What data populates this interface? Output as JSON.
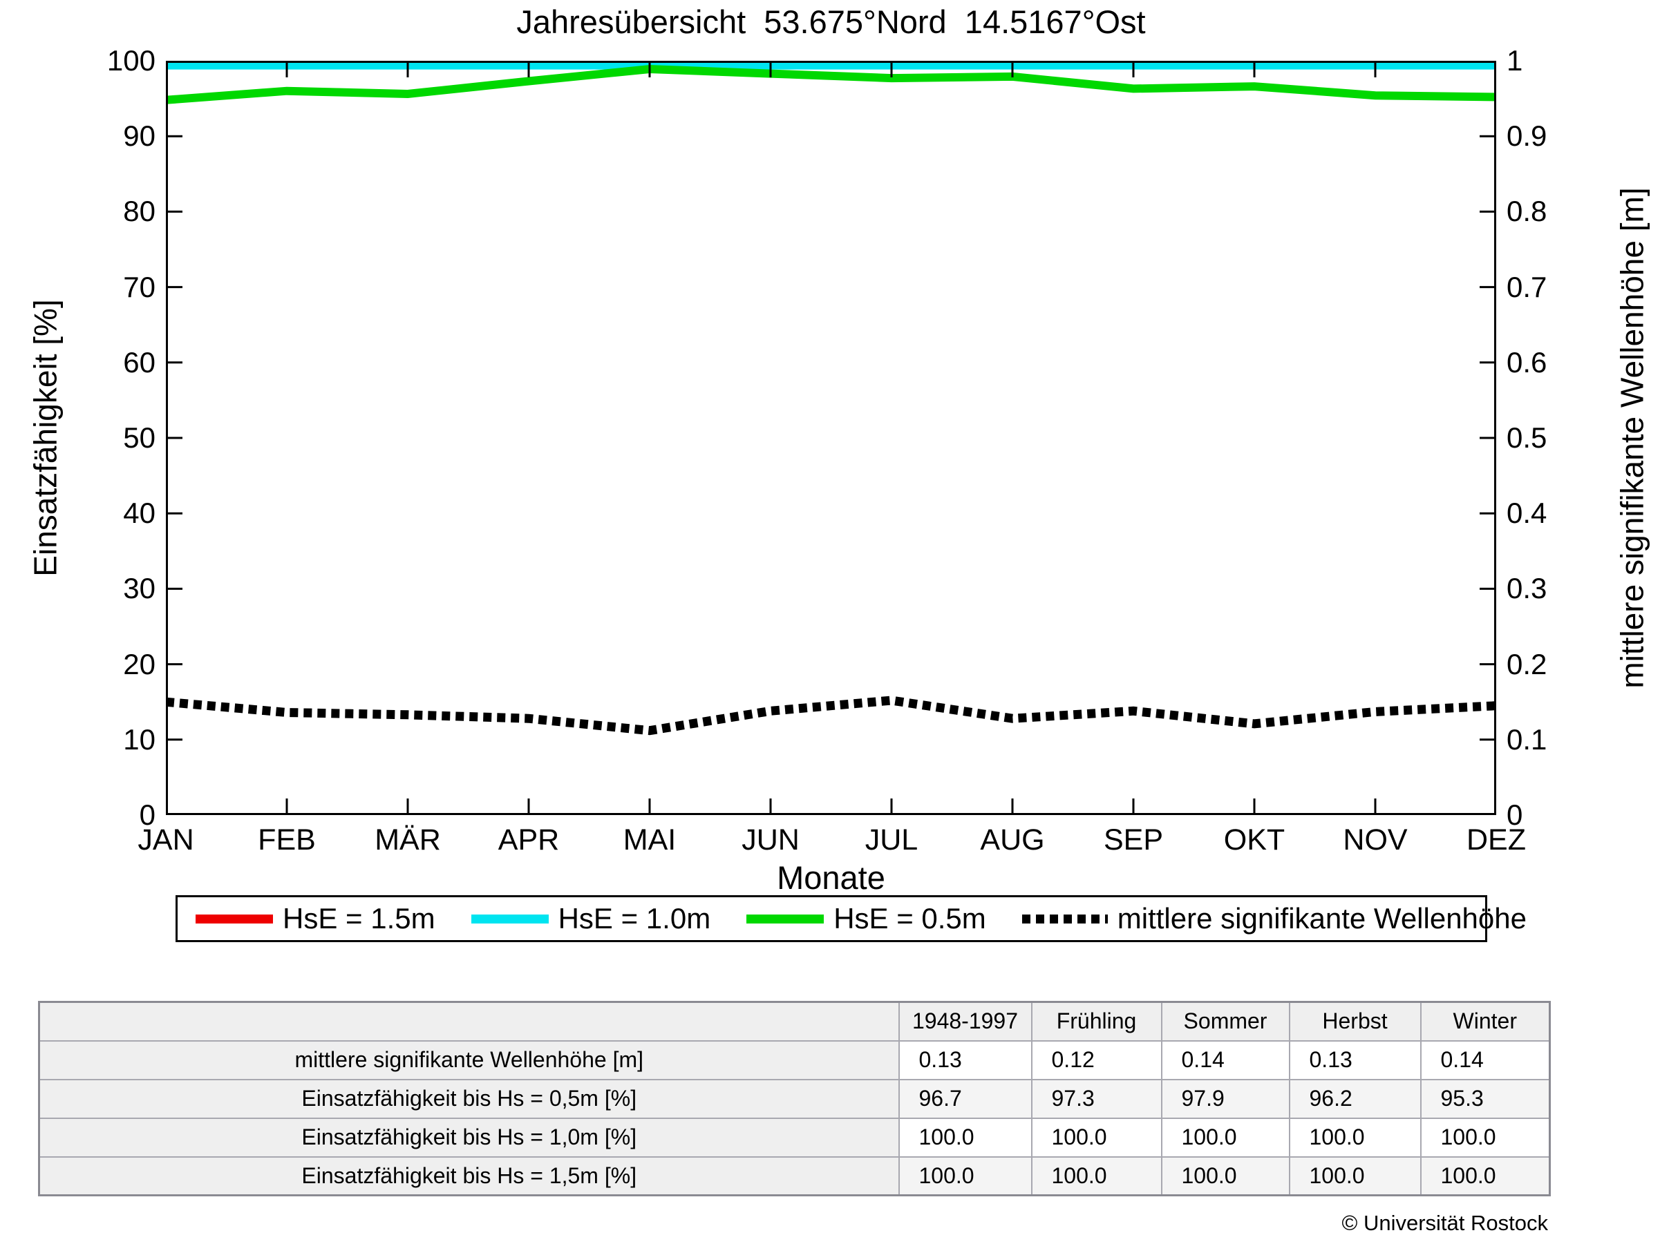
{
  "title": "Jahresübersicht  53.675°Nord  14.5167°Ost",
  "chart_data": {
    "type": "line",
    "categories": [
      "JAN",
      "FEB",
      "MÄR",
      "APR",
      "MAI",
      "JUN",
      "JUL",
      "AUG",
      "SEP",
      "OKT",
      "NOV",
      "DEZ"
    ],
    "xlabel": "Monate",
    "left_axis": {
      "label": "Einsatzfähigkeit [%]",
      "range": [
        0,
        100
      ],
      "ticks": [
        "0",
        "10",
        "20",
        "30",
        "40",
        "50",
        "60",
        "70",
        "80",
        "90",
        "100"
      ]
    },
    "right_axis": {
      "label": "mittlere signifikante Wellenhöhe [m]",
      "range": [
        0,
        1
      ],
      "ticks": [
        "0",
        "0.1",
        "0.2",
        "0.3",
        "0.4",
        "0.5",
        "0.6",
        "0.7",
        "0.8",
        "0.9",
        "1"
      ]
    },
    "grid": false,
    "legend_position": "bottom",
    "series": [
      {
        "name": "HsE = 1.5m",
        "color": "#ee0000",
        "axis": "left",
        "style": "solid",
        "values": [
          100,
          100,
          100,
          100,
          100,
          100,
          100,
          100,
          100,
          100,
          100,
          100
        ]
      },
      {
        "name": "HsE = 1.0m",
        "color": "#00e4f0",
        "axis": "left",
        "style": "solid",
        "values": [
          99.4,
          99.4,
          99.4,
          99.4,
          99.4,
          99.4,
          99.4,
          99.4,
          99.4,
          99.4,
          99.4,
          99.4
        ]
      },
      {
        "name": "HsE = 0.5m",
        "color": "#00d800",
        "axis": "left",
        "style": "solid",
        "values": [
          94.8,
          96.0,
          95.6,
          97.3,
          98.9,
          98.3,
          97.7,
          97.9,
          96.3,
          96.6,
          95.4,
          95.2
        ]
      },
      {
        "name": "mittlere signifikante Wellenhöhe",
        "color": "#000000",
        "axis": "right",
        "style": "dotted",
        "values": [
          0.15,
          0.136,
          0.133,
          0.128,
          0.112,
          0.138,
          0.152,
          0.128,
          0.138,
          0.121,
          0.137,
          0.145
        ]
      }
    ]
  },
  "table": {
    "columns": [
      "1948-1997",
      "Frühling",
      "Sommer",
      "Herbst",
      "Winter"
    ],
    "rows": [
      {
        "label": "mittlere signifikante Wellenhöhe [m]",
        "values": [
          "0.13",
          "0.12",
          "0.14",
          "0.13",
          "0.14"
        ]
      },
      {
        "label": "Einsatzfähigkeit bis Hs = 0,5m [%]",
        "values": [
          "96.7",
          "97.3",
          "97.9",
          "96.2",
          "95.3"
        ]
      },
      {
        "label": "Einsatzfähigkeit bis Hs = 1,0m [%]",
        "values": [
          "100.0",
          "100.0",
          "100.0",
          "100.0",
          "100.0"
        ]
      },
      {
        "label": "Einsatzfähigkeit bis Hs = 1,5m [%]",
        "values": [
          "100.0",
          "100.0",
          "100.0",
          "100.0",
          "100.0"
        ]
      }
    ]
  },
  "copyright": "© Universität Rostock"
}
